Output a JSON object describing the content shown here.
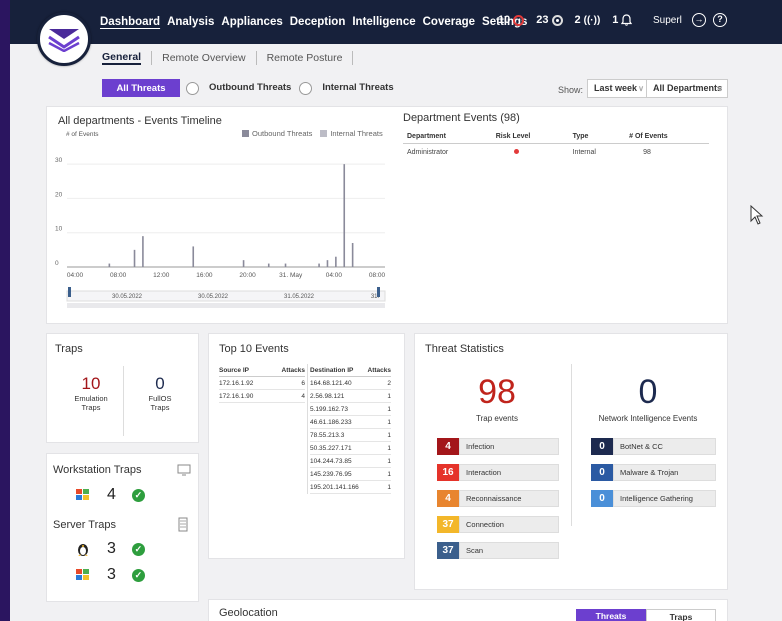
{
  "nav": {
    "items": [
      "Dashboard",
      "Analysis",
      "Appliances",
      "Deception",
      "Intelligence",
      "Coverage",
      "Settings"
    ],
    "active": "Dashboard"
  },
  "counters": [
    {
      "value": "10",
      "icon": "alert-ring-icon",
      "color": "#e23a3a"
    },
    {
      "value": "23",
      "icon": "radio-icon",
      "color": "#ffffff"
    },
    {
      "value": "2",
      "icon": "signal-icon",
      "color": "#ffffff"
    },
    {
      "value": "1",
      "icon": "bell-icon",
      "color": "#ffffff"
    }
  ],
  "user": {
    "name": "Superl"
  },
  "subnav": {
    "items": [
      "General",
      "Remote Overview",
      "Remote Posture"
    ],
    "active": "General"
  },
  "threat_tabs": {
    "all": "All Threats",
    "outbound": "Outbound Threats",
    "internal": "Internal Threats"
  },
  "filters": {
    "show_label": "Show:",
    "period": "Last week",
    "department": "All Departments"
  },
  "timeline": {
    "title": "All departments - Events Timeline",
    "ylabel": "# of Events",
    "legend": [
      "Outbound Threats",
      "Internal Threats"
    ],
    "yticks": [
      "30",
      "20",
      "10",
      "0"
    ],
    "xticks": [
      "04:00",
      "08:00",
      "12:00",
      "16:00",
      "20:00",
      "31. May",
      "04:00",
      "08:00"
    ],
    "nav_dates": [
      "30.05.2022",
      "30.05.2022",
      "31.05.2022",
      "31."
    ],
    "colors": {
      "outbound": "#8a8a9a",
      "internal": "#bcbcc6"
    }
  },
  "chart_data": {
    "type": "bar",
    "title": "All departments - Events Timeline",
    "ylabel": "# of Events",
    "ylim": [
      0,
      35
    ],
    "x": [
      "30.05 04:00",
      "30.05 07:00",
      "30.05 08:00",
      "30.05 14:00",
      "30.05 20:00",
      "30.05 23:00",
      "31.05 01:00",
      "31.05 05:00",
      "31.05 06:00",
      "31.05 07:00",
      "31.05 08:00",
      "31.05 09:00"
    ],
    "series": [
      {
        "name": "Outbound Threats",
        "values": [
          1,
          5,
          9,
          6,
          2,
          1,
          1,
          1,
          2,
          3,
          30,
          7
        ]
      }
    ]
  },
  "department_events": {
    "title": "Department Events (98)",
    "columns": [
      "Department",
      "Risk Level",
      "Type",
      "# Of Events"
    ],
    "rows": [
      {
        "department": "Administrator",
        "risk_color": "#e23a3a",
        "type": "Internal",
        "events": "98"
      }
    ]
  },
  "traps": {
    "title": "Traps",
    "emulation": {
      "value": "10",
      "label1": "Emulation",
      "label2": "Traps"
    },
    "fullos": {
      "value": "0",
      "label1": "FullOS",
      "label2": "Traps"
    }
  },
  "workstation_traps": {
    "title": "Workstation Traps",
    "rows": [
      {
        "os": "windows-icon",
        "count": "4"
      }
    ]
  },
  "server_traps": {
    "title": "Server Traps",
    "rows": [
      {
        "os": "linux-icon",
        "count": "3"
      },
      {
        "os": "windows-icon",
        "count": "3"
      }
    ]
  },
  "top10": {
    "title": "Top 10 Events",
    "source_headers": [
      "Source IP",
      "Attacks"
    ],
    "dest_headers": [
      "Destination IP",
      "Attacks"
    ],
    "sources": [
      {
        "ip": "172.16.1.92",
        "attacks": "6"
      },
      {
        "ip": "172.16.1.90",
        "attacks": "4"
      }
    ],
    "destinations": [
      {
        "ip": "164.68.121.40",
        "attacks": "2"
      },
      {
        "ip": "2.56.98.121",
        "attacks": "1"
      },
      {
        "ip": "5.199.162.73",
        "attacks": "1"
      },
      {
        "ip": "46.61.186.233",
        "attacks": "1"
      },
      {
        "ip": "78.55.213.3",
        "attacks": "1"
      },
      {
        "ip": "50.35.227.171",
        "attacks": "1"
      },
      {
        "ip": "104.244.73.85",
        "attacks": "1"
      },
      {
        "ip": "145.239.76.95",
        "attacks": "1"
      },
      {
        "ip": "195.201.141.166",
        "attacks": "1"
      }
    ]
  },
  "threat_stats": {
    "title": "Threat Statistics",
    "trap_events": {
      "value": "98",
      "label": "Trap events",
      "color": "#c0241c"
    },
    "network_events": {
      "value": "0",
      "label": "Network Intelligence Events",
      "color": "#1d2a4f"
    },
    "trap_rows": [
      {
        "value": "4",
        "label": "Infection",
        "color": "#a3161a"
      },
      {
        "value": "16",
        "label": "Interaction",
        "color": "#e5332a"
      },
      {
        "value": "4",
        "label": "Reconnaissance",
        "color": "#e8852f"
      },
      {
        "value": "37",
        "label": "Connection",
        "color": "#f3b72a"
      },
      {
        "value": "37",
        "label": "Scan",
        "color": "#3b5f8c"
      }
    ],
    "network_rows": [
      {
        "value": "0",
        "label": "BotNet & CC",
        "color": "#1d2a4f"
      },
      {
        "value": "0",
        "label": "Malware & Trojan",
        "color": "#2b5aa3"
      },
      {
        "value": "0",
        "label": "Intelligence Gathering",
        "color": "#4a8fd8"
      }
    ]
  },
  "geolocation": {
    "title": "Geolocation",
    "tabs": [
      "Threats",
      "Traps"
    ],
    "active": "Threats"
  }
}
